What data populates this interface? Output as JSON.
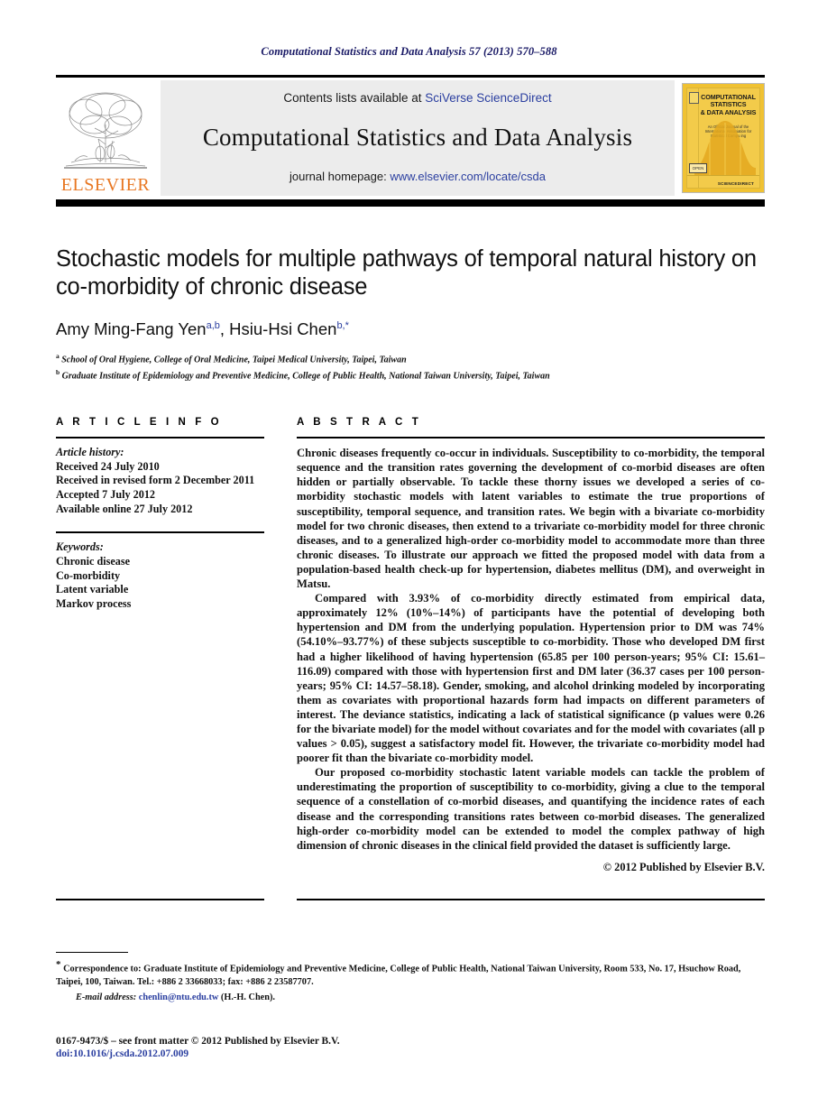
{
  "running_head": "Computational Statistics and Data Analysis 57 (2013) 570–588",
  "header": {
    "contents_prefix": "Contents lists available at ",
    "contents_link": "SciVerse ScienceDirect",
    "journal_title": "Computational Statistics and Data Analysis",
    "homepage_prefix": "journal homepage: ",
    "homepage_link": "www.elsevier.com/locate/csda",
    "publisher_logo_text": "ELSEVIER",
    "cover": {
      "title_line1": "COMPUTATIONAL",
      "title_line2": "STATISTICS",
      "title_line3": "& DATA ANALYSIS",
      "subtitle": "An Official Journal of the International Association for Statistical Computing",
      "bottom_text": "SCIENCEDIRECT",
      "ebadge_text": "OPEN"
    }
  },
  "title": "Stochastic models for multiple pathways of temporal natural history on co-morbidity of chronic disease",
  "authors": {
    "author1_name": "Amy Ming-Fang Yen",
    "author1_sup": "a,b",
    "separator": ", ",
    "author2_name": "Hsiu-Hsi Chen",
    "author2_sup": "b,*"
  },
  "affiliations": [
    {
      "marker": "a",
      "text": "School of Oral Hygiene, College of Oral Medicine, Taipei Medical University, Taipei, Taiwan"
    },
    {
      "marker": "b",
      "text": "Graduate Institute of Epidemiology and Preventive Medicine, College of Public Health, National Taiwan University, Taipei, Taiwan"
    }
  ],
  "article_info": {
    "heading": "A R T I C L E   I N F O",
    "history_label": "Article history:",
    "history": [
      "Received 24 July 2010",
      "Received in revised form 2 December 2011",
      "Accepted 7 July 2012",
      "Available online 27 July 2012"
    ],
    "keywords_label": "Keywords:",
    "keywords": [
      "Chronic disease",
      "Co-morbidity",
      "Latent variable",
      "Markov process"
    ]
  },
  "abstract": {
    "heading": "A B S T R A C T",
    "paragraphs": [
      "Chronic diseases frequently co-occur in individuals. Susceptibility to co-morbidity, the temporal sequence and the transition rates governing the development of co-morbid diseases are often hidden or partially observable. To tackle these thorny issues we developed a series of co-morbidity stochastic models with latent variables to estimate the true proportions of susceptibility, temporal sequence, and transition rates. We begin with a bivariate co-morbidity model for two chronic diseases, then extend to a trivariate co-morbidity model for three chronic diseases, and to a generalized high-order co-morbidity model to accommodate more than three chronic diseases. To illustrate our approach we fitted the proposed model with data from a population-based health check-up for hypertension, diabetes mellitus (DM), and overweight in Matsu.",
      "Compared with 3.93% of co-morbidity directly estimated from empirical data, approximately 12% (10%–14%) of participants have the potential of developing both hypertension and DM from the underlying population. Hypertension prior to DM was 74% (54.10%–93.77%) of these subjects susceptible to co-morbidity. Those who developed DM first had a higher likelihood of having hypertension (65.85 per 100 person-years; 95% CI: 15.61–116.09) compared with those with hypertension first and DM later (36.37 cases per 100 person-years; 95% CI: 14.57–58.18). Gender, smoking, and alcohol drinking modeled by incorporating them as covariates with proportional hazards form had impacts on different parameters of interest. The deviance statistics, indicating a lack of statistical significance (p values were 0.26 for the bivariate model) for the model without covariates and for the model with covariates (all p values > 0.05), suggest a satisfactory model fit. However, the trivariate co-morbidity model had poorer fit than the bivariate co-morbidity model.",
      "Our proposed co-morbidity stochastic latent variable models can tackle the problem of underestimating the proportion of susceptibility to co-morbidity, giving a clue to the temporal sequence of a constellation of co-morbid diseases, and quantifying the incidence rates of each disease and the corresponding transitions rates between co-morbid diseases. The generalized high-order co-morbidity model can be extended to model the complex pathway of high dimension of chronic diseases in the clinical field provided the dataset is sufficiently large."
    ],
    "copyright": "© 2012 Published by Elsevier B.V."
  },
  "footnote": {
    "star": "*",
    "correspondence": "Correspondence to: Graduate Institute of Epidemiology and Preventive Medicine, College of Public Health, National Taiwan University, Room 533, No. 17, Hsuchow Road, Taipei, 100, Taiwan. Tel.: +886 2 33668033; fax: +886 2 23587707.",
    "email_label": "E-mail address:",
    "email_address": "chenlin@ntu.edu.tw",
    "email_suffix": "(H.-H. Chen)."
  },
  "footer": {
    "issn_line": "0167-9473/$ – see front matter © 2012 Published by Elsevier B.V.",
    "doi_line": "doi:10.1016/j.csda.2012.07.009"
  },
  "colors": {
    "link_blue": "#2b3fa0",
    "running_head_navy": "#1a1a66",
    "elsevier_orange": "#E87722",
    "cover_yellow": "#f3cb4a"
  }
}
